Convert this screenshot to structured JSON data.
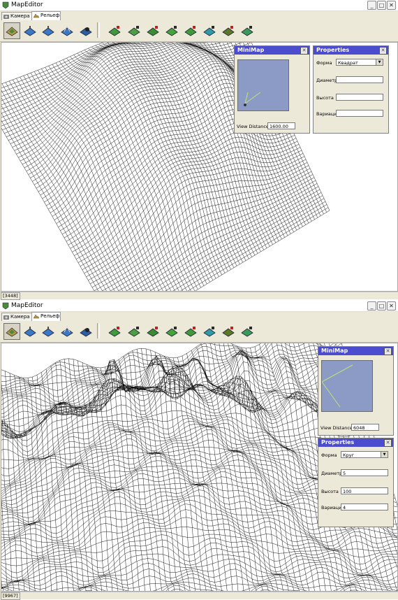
{
  "window_top": {
    "title": "MapEditor",
    "tabs": [
      {
        "label": "Камера"
      },
      {
        "label": "Рельеф"
      }
    ],
    "status": "[3448]",
    "minimap": {
      "title": "MiniMap",
      "view_distance_label": "View Distance",
      "view_distance_value": "1600.00"
    },
    "properties": {
      "title": "Properties",
      "form_label": "Форма",
      "form_value": "Квадрат",
      "diameter_label": "Диаметр",
      "diameter_value": "",
      "height_label": "Высота",
      "height_value": "",
      "variation_label": "Вариация",
      "variation_value": ""
    }
  },
  "window_bottom": {
    "title": "MapEditor",
    "tabs": [
      {
        "label": "Камера"
      },
      {
        "label": "Рельеф"
      }
    ],
    "status": "[9967]",
    "minimap": {
      "title": "MiniMap",
      "view_distance_label": "View Distance",
      "view_distance_value": "6048"
    },
    "properties": {
      "title": "Properties",
      "form_label": "Форма",
      "form_value": "Круг",
      "diameter_label": "Диаметр",
      "diameter_value": "5",
      "height_label": "Высота",
      "height_value": "100",
      "variation_label": "Вариация",
      "variation_value": "4"
    }
  },
  "toolbar_icons": [
    "terrain-raise-icon",
    "terrain-lower-icon",
    "terrain-flatten-icon",
    "terrain-noise-icon",
    "terrain-smooth-icon",
    "texture-brush-1-icon",
    "texture-brush-2-icon",
    "texture-brush-3-icon",
    "texture-brush-4-icon",
    "texture-brush-5-icon",
    "texture-brush-6-icon",
    "texture-brush-7-icon",
    "texture-brush-8-icon"
  ],
  "colors": {
    "accent": "#4c4ccf",
    "minimap_bg": "#8c9bc5",
    "chrome": "#ece9d8"
  }
}
